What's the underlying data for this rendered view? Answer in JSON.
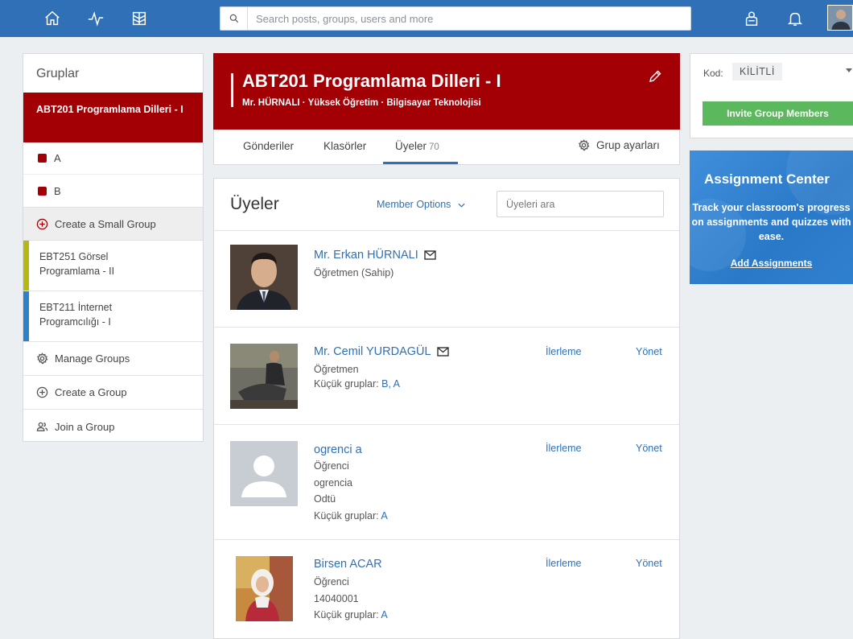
{
  "topbar": {
    "search_placeholder": "Search posts, groups, users and more",
    "icons": [
      "home-icon",
      "activity-icon",
      "library-icon",
      "backpack-icon",
      "bell-icon"
    ],
    "color": "#2f70b7"
  },
  "sidebar": {
    "title": "Gruplar",
    "active_group": "ABT201 Programlama Dilleri - I",
    "small_groups": [
      "A",
      "B"
    ],
    "create_small_group": "Create a Small Group",
    "groups": [
      {
        "label": "EBT251 Görsel Programlama - II",
        "color": "#b5b812"
      },
      {
        "label": "EBT211 İnternet Programcılığı - I",
        "color": "#2f80c6"
      }
    ],
    "manage_groups": "Manage Groups",
    "create_group": "Create a Group",
    "join_group": "Join a Group"
  },
  "group": {
    "title": "ABT201 Programlama Dilleri - I",
    "subtitle": "Mr. HÜRNALI · Yüksek Öğretim · Bilgisayar Teknolojisi",
    "color": "#a30006"
  },
  "tabs": {
    "posts": "Gönderiler",
    "folders": "Klasörler",
    "members": "Üyeler",
    "members_count": "70",
    "settings": "Grup ayarları"
  },
  "members": {
    "title": "Üyeler",
    "options": "Member Options",
    "search_placeholder": "Üyeleri ara",
    "progress_label": "İlerleme",
    "manage_label": "Yönet",
    "small_groups_prefix": "Küçük gruplar:",
    "list": [
      {
        "name": "Mr. Erkan HÜRNALI",
        "role": "Öğretmen (Sahip)"
      },
      {
        "name": "Mr. Cemil YURDAGÜL",
        "role": "Öğretmen",
        "groups": "B, A"
      },
      {
        "name": "ogrenci a",
        "role": "Öğrenci",
        "username": "ogrencia",
        "school": "Odtü",
        "groups": "A"
      },
      {
        "name": "Birsen ACAR",
        "role": "Öğrenci",
        "username": "14040001",
        "groups": "A"
      }
    ]
  },
  "code": {
    "label": "Kod:",
    "value": "KİLİTLİ"
  },
  "invite_button": "Invite Group Members",
  "assignment": {
    "title": "Assignment Center",
    "description": "Track your classroom's progress on assignments and quizzes with ease.",
    "link": "Add Assignments"
  }
}
